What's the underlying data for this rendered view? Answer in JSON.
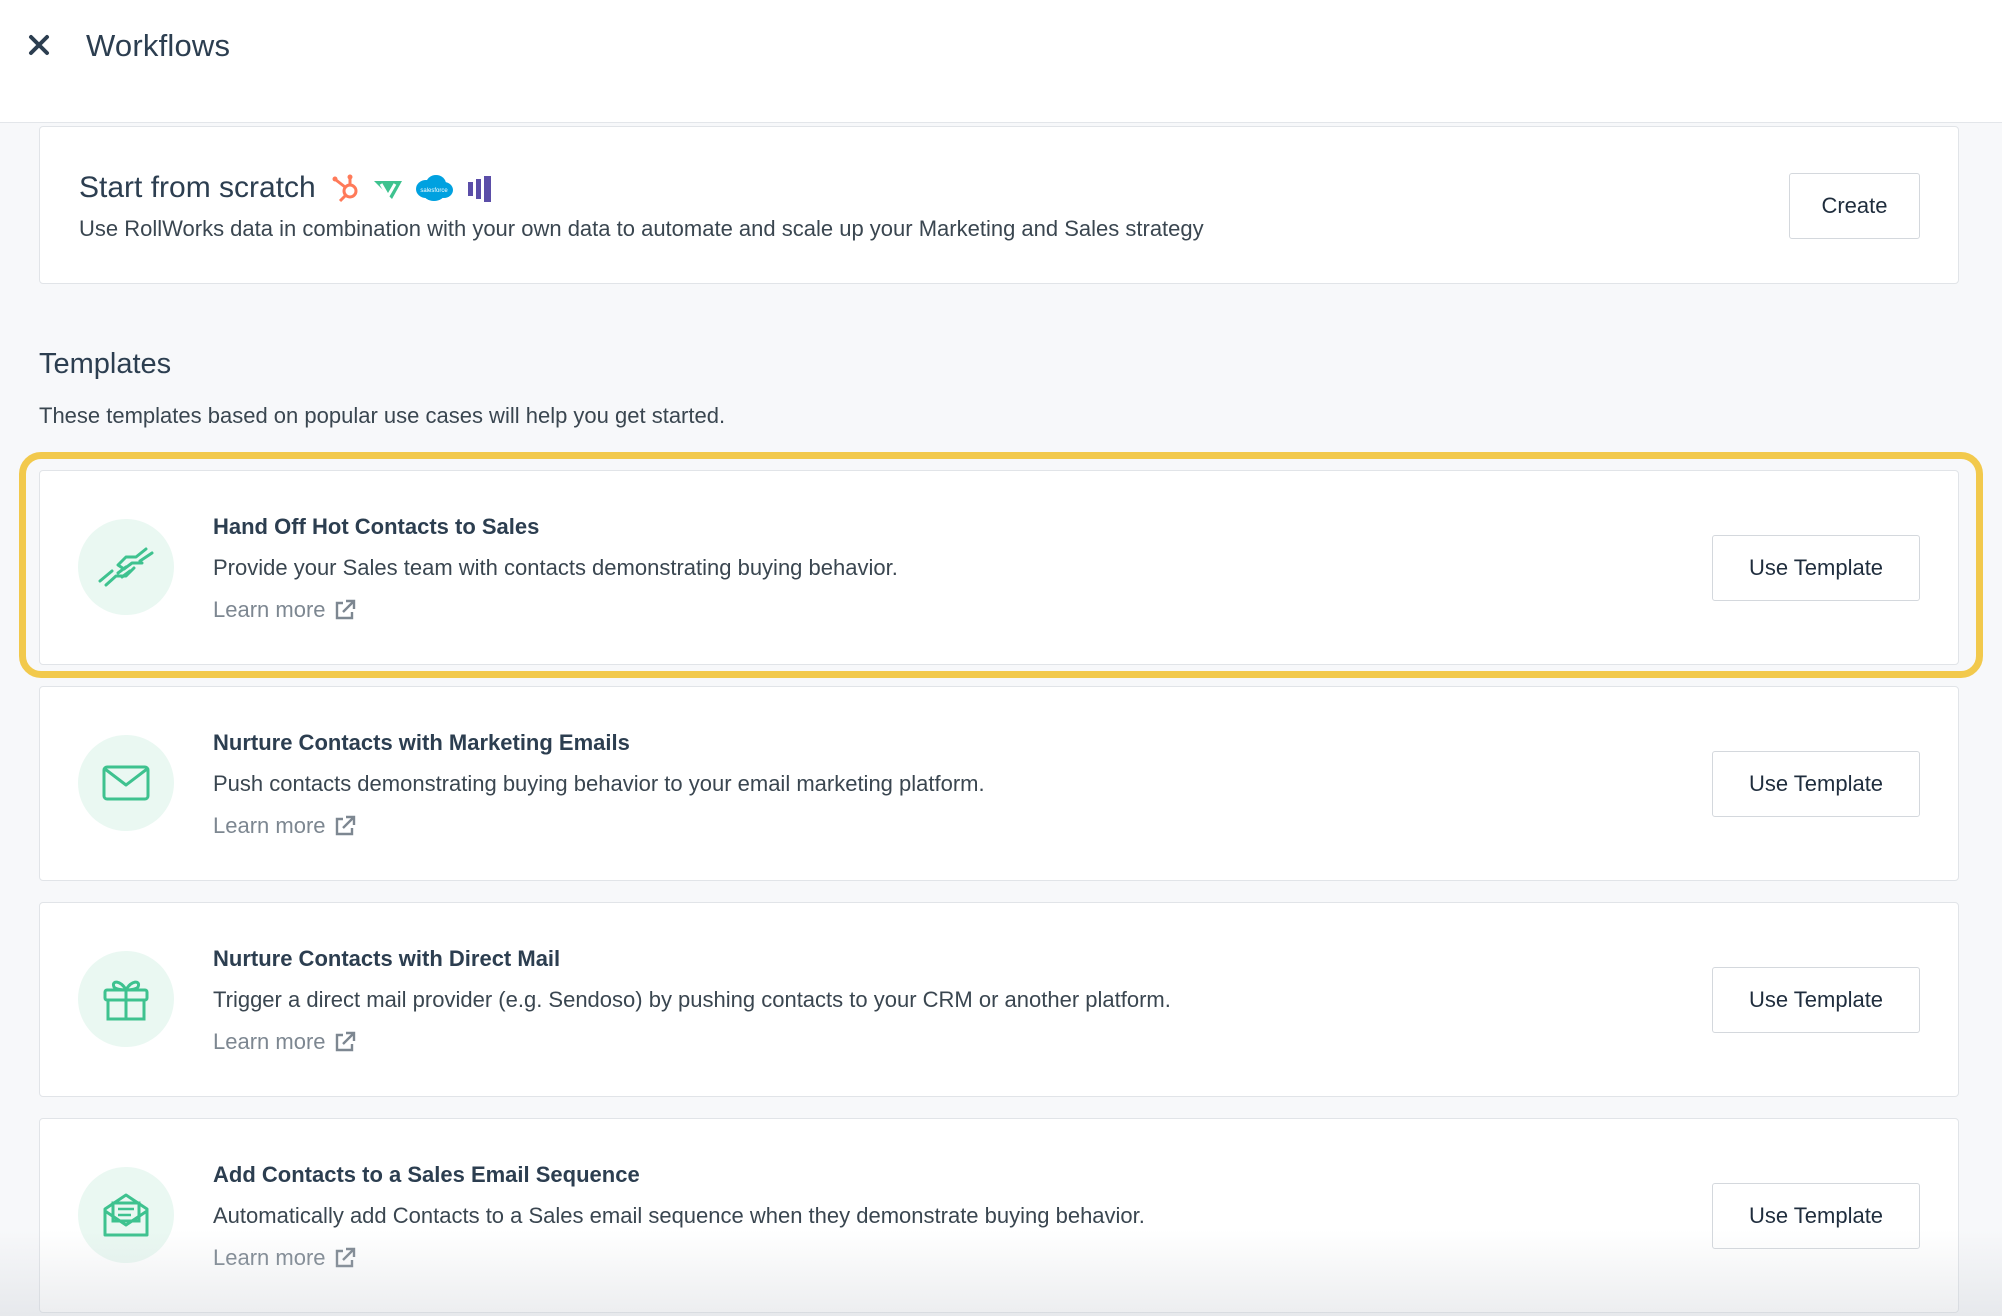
{
  "header": {
    "title": "Workflows"
  },
  "scratch": {
    "title": "Start from scratch",
    "logos": [
      "hubspot-logo",
      "vitally-logo",
      "salesforce-logo",
      "rollworks-logo"
    ],
    "salesforce_logo_text": "salesforce",
    "description": "Use RollWorks data in combination with your own data to automate and scale up your Marketing and Sales strategy",
    "create_label": "Create"
  },
  "templates": {
    "title": "Templates",
    "subtitle": "These templates based on popular use cases will help you get started.",
    "items": [
      {
        "icon": "handshake-icon",
        "title": "Hand Off Hot Contacts to Sales",
        "description": "Provide your Sales team with contacts demonstrating buying behavior.",
        "learn_more": "Learn more",
        "button_label": "Use Template",
        "highlighted": true
      },
      {
        "icon": "envelope-icon",
        "title": "Nurture Contacts with Marketing Emails",
        "description": "Push contacts demonstrating buying behavior to your email marketing platform.",
        "learn_more": "Learn more",
        "button_label": "Use Template",
        "highlighted": false
      },
      {
        "icon": "gift-icon",
        "title": "Nurture Contacts with Direct Mail",
        "description": "Trigger a direct mail provider (e.g. Sendoso) by pushing contacts to your CRM or another platform.",
        "learn_more": "Learn more",
        "button_label": "Use Template",
        "highlighted": false
      },
      {
        "icon": "open-envelope-icon",
        "title": "Add Contacts to a Sales Email Sequence",
        "description": "Automatically add Contacts to a Sales email sequence when they demonstrate buying behavior.",
        "learn_more": "Learn more",
        "button_label": "Use Template",
        "highlighted": false
      }
    ]
  },
  "colors": {
    "accent_green": "#3ec28f",
    "icon_bg": "#eaf8f2",
    "highlight": "#f2c94c",
    "hubspot": "#ff7a59",
    "salesforce": "#00a1e0",
    "rollworks": "#5b4ea8"
  }
}
